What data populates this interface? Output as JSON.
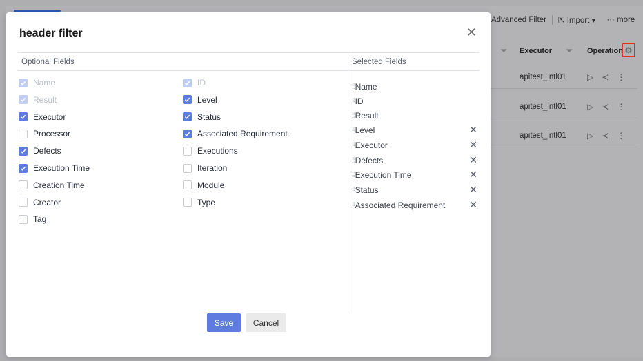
{
  "background": {
    "toolbar": {
      "advanced_filter": "Advanced Filter",
      "import": "Import",
      "more": "more"
    },
    "table": {
      "headers": {
        "executor": "Executor",
        "operation": "Operation"
      },
      "rows": [
        {
          "executor": "apitest_intl01"
        },
        {
          "executor": "apitest_intl01"
        },
        {
          "executor": "apitest_intl01"
        }
      ]
    }
  },
  "dialog": {
    "title": "header filter",
    "optional_fields_label": "Optional Fields",
    "selected_fields_label": "Selected Fields",
    "optional_fields": [
      {
        "label": "Name",
        "state": "disabled-checked"
      },
      {
        "label": "ID",
        "state": "disabled-checked"
      },
      {
        "label": "Result",
        "state": "disabled-checked"
      },
      {
        "label": "Level",
        "state": "checked"
      },
      {
        "label": "Executor",
        "state": "checked"
      },
      {
        "label": "Status",
        "state": "checked"
      },
      {
        "label": "Processor",
        "state": "unchecked"
      },
      {
        "label": "Associated Requirement",
        "state": "checked"
      },
      {
        "label": "Defects",
        "state": "checked"
      },
      {
        "label": "Executions",
        "state": "unchecked"
      },
      {
        "label": "Execution Time",
        "state": "checked"
      },
      {
        "label": "Iteration",
        "state": "unchecked"
      },
      {
        "label": "Creation Time",
        "state": "unchecked"
      },
      {
        "label": "Module",
        "state": "unchecked"
      },
      {
        "label": "Creator",
        "state": "unchecked"
      },
      {
        "label": "Type",
        "state": "unchecked"
      },
      {
        "label": "Tag",
        "state": "unchecked"
      }
    ],
    "selected_fields": [
      {
        "label": "Name",
        "removable": false
      },
      {
        "label": "ID",
        "removable": false
      },
      {
        "label": "Result",
        "removable": false
      },
      {
        "label": "Level",
        "removable": true
      },
      {
        "label": "Executor",
        "removable": true
      },
      {
        "label": "Defects",
        "removable": true
      },
      {
        "label": "Execution Time",
        "removable": true
      },
      {
        "label": "Status",
        "removable": true
      },
      {
        "label": "Associated Requirement",
        "removable": true
      }
    ],
    "save_label": "Save",
    "cancel_label": "Cancel"
  },
  "colors": {
    "primary": "#5e7ce0",
    "highlight_border": "#e0302a"
  }
}
